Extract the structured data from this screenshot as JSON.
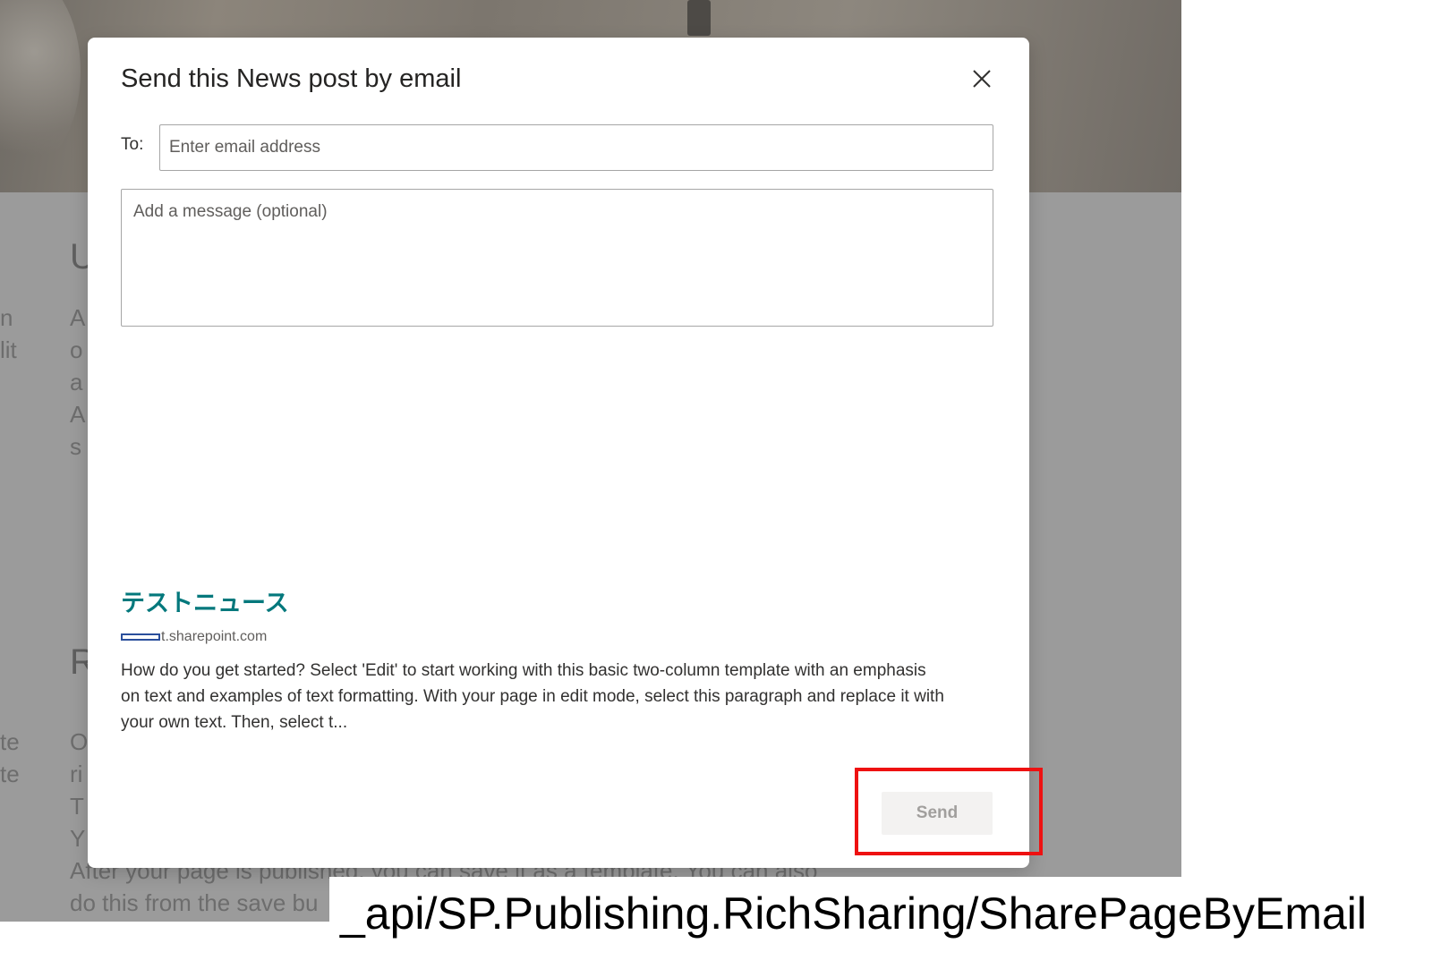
{
  "background": {
    "heading_fragment_1": "U",
    "heading_fragment_2": "R",
    "left_fragments": [
      "n",
      "lit",
      "te",
      "te"
    ],
    "col_fragments_1": [
      "A",
      "o",
      "a",
      "A",
      "s"
    ],
    "col_fragments_2": [
      "O",
      "ri",
      "T",
      "Y"
    ],
    "footer_line_1": "After your page is published, you can save it as a template. You can also",
    "footer_line_2": "do this from the save bu"
  },
  "dialog": {
    "title": "Send this News post by email",
    "close_icon": "close-icon",
    "to_label": "To:",
    "to_placeholder": "Enter email address",
    "message_placeholder": "Add a message (optional)",
    "preview": {
      "title": "テストニュース",
      "site": "t.sharepoint.com",
      "description": "How do you get started? Select 'Edit' to start working with this basic two-column template with an emphasis on text and examples of text formatting. With your page in edit mode, select this paragraph and replace it with your own text. Then, select t..."
    },
    "send_label": "Send"
  },
  "annotation": {
    "highlight_color": "#ee1111",
    "api_endpoint": "_api/SP.Publishing.RichSharing/SharePageByEmail"
  },
  "colors": {
    "accent": "#03787c",
    "overlay": "#9b9b9b",
    "disabled_text": "#a19f9d"
  }
}
